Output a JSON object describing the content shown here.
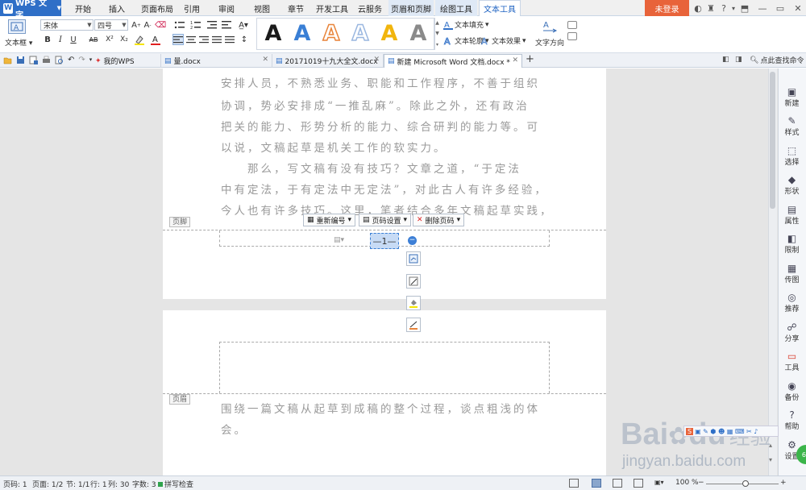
{
  "app": {
    "name": "WPS 文字",
    "logo": "W"
  },
  "menu": {
    "tabs": [
      "开始",
      "插入",
      "页面布局",
      "引用",
      "审阅",
      "视图",
      "章节",
      "开发工具",
      "云服务",
      "页眉和页脚",
      "绘图工具",
      "文本工具"
    ],
    "login": "未登录"
  },
  "ribbon": {
    "textbox": "文本框",
    "font_name": "宋体",
    "font_size": "四号",
    "bold": "B",
    "italic": "I",
    "underline": "U",
    "strike": "AB",
    "superscript": "X²",
    "subscript": "X₂",
    "text_fill": "文本填充",
    "text_outline": "文本轮廓",
    "text_effect": "文本效果",
    "text_direction": "文字方向",
    "style_letter": "A",
    "style_colors": [
      "#1a1a1a",
      "#3a7fd5",
      "#e8843a",
      "#9ab7e0",
      "#f1b50d",
      "#8a8a8a"
    ],
    "style_kinds": [
      "solid",
      "solid",
      "outline",
      "outline",
      "solid",
      "solid"
    ]
  },
  "tabs": {
    "docs": [
      {
        "label": "我的WPS"
      },
      {
        "label": "量.docx"
      },
      {
        "label": "20171019十九大全文.docx"
      },
      {
        "label": "新建 Microsoft Word 文档.docx *"
      }
    ],
    "add": "+",
    "search": "点此查找命令"
  },
  "document": {
    "lines_top": [
      "安排人员，不熟悉业务、职能和工作程序，不善于组织",
      "协调，势必安排成“一推乱麻”。除此之外，还有政治",
      "把关的能力、形势分析的能力、综合研判的能力等。可",
      "以说，文稿起草是机关工作的软实力。",
      "　　那么，写文稿有没有技巧？文章之道，“于定法",
      "中有定法，于有定法中无定法”，对此古人有许多经验，",
      "今人也有许多技巧。这里，笔者结合多年文稿起草实践，"
    ],
    "footer_label": "页脚",
    "header_label": "页眉",
    "renumber": "重新编号",
    "page_settings": "页码设置",
    "delete_page_num": "删除页码",
    "page_number": "—1—",
    "lines_bottom": [
      "围绕一篇文稿从起草到成稿的整个过程，谈点粗浅的体",
      "会。"
    ]
  },
  "sidebar": {
    "items": [
      "新建",
      "样式",
      "选择",
      "形状",
      "属性",
      "限制",
      "传图",
      "推荐",
      "分享",
      "工具",
      "备份",
      "帮助",
      "设置"
    ]
  },
  "status": {
    "page_code": "页码: 1",
    "page": "页面: 1/2",
    "section": "节: 1/1",
    "row": "行: 1",
    "col": "列: 30",
    "words": "字数: 3",
    "spell": "拼写检查",
    "zoom": "100 %"
  },
  "watermark": {
    "brand": "Bai",
    "brand2": "du",
    "cn": "经验",
    "url": "jingyan.baidu.com"
  }
}
